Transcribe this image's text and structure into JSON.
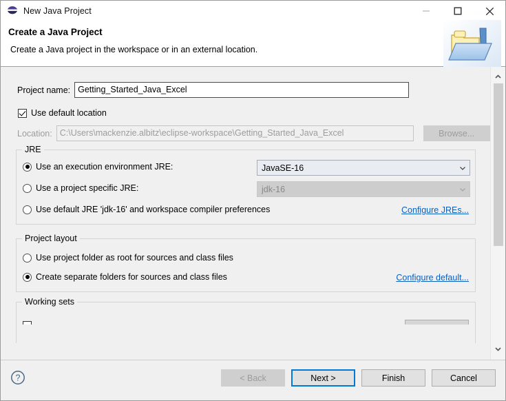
{
  "window": {
    "title": "New Java Project",
    "icon": "eclipse-icon",
    "controls": {
      "minimize": "minimize-icon",
      "maximize": "maximize-icon",
      "close": "close-icon"
    }
  },
  "header": {
    "title": "Create a Java Project",
    "description": "Create a Java project in the workspace or in an external location.",
    "art": "java-project-folder-icon"
  },
  "form": {
    "project_name": {
      "label": "Project name:",
      "value": "Getting_Started_Java_Excel",
      "placeholder": ""
    },
    "use_default_location": {
      "label": "Use default location",
      "checked": true
    },
    "location": {
      "label": "Location:",
      "value": "C:\\Users\\mackenzie.albitz\\eclipse-workspace\\Getting_Started_Java_Excel",
      "enabled": false
    },
    "browse_button": {
      "label": "Browse...",
      "enabled": false
    }
  },
  "jre_group": {
    "title": "JRE",
    "options": [
      {
        "label": "Use an execution environment JRE:",
        "selected": true,
        "combo_value": "JavaSE-16",
        "combo_enabled": true
      },
      {
        "label": "Use a project specific JRE:",
        "selected": false,
        "combo_value": "jdk-16",
        "combo_enabled": false
      },
      {
        "label": "Use default JRE 'jdk-16' and workspace compiler preferences",
        "selected": false
      }
    ],
    "link": "Configure JREs..."
  },
  "project_layout_group": {
    "title": "Project layout",
    "options": [
      {
        "label": "Use project folder as root for sources and class files",
        "selected": false
      },
      {
        "label": "Create separate folders for sources and class files",
        "selected": true
      }
    ],
    "link": "Configure default..."
  },
  "working_sets_group": {
    "title": "Working sets"
  },
  "scrollbar": {
    "up_arrow": "chevron-up-icon",
    "down_arrow": "chevron-down-icon"
  },
  "footer": {
    "help": "help-icon",
    "buttons": [
      {
        "label": "< Back",
        "enabled": false,
        "focused": false
      },
      {
        "label": "Next >",
        "enabled": true,
        "focused": true
      },
      {
        "label": "Finish",
        "enabled": true,
        "focused": false
      },
      {
        "label": "Cancel",
        "enabled": true,
        "focused": false
      }
    ]
  },
  "colors": {
    "link": "#0a5fbf",
    "focus": "#0078d7",
    "dialog_bg": "#f0f0f0"
  }
}
